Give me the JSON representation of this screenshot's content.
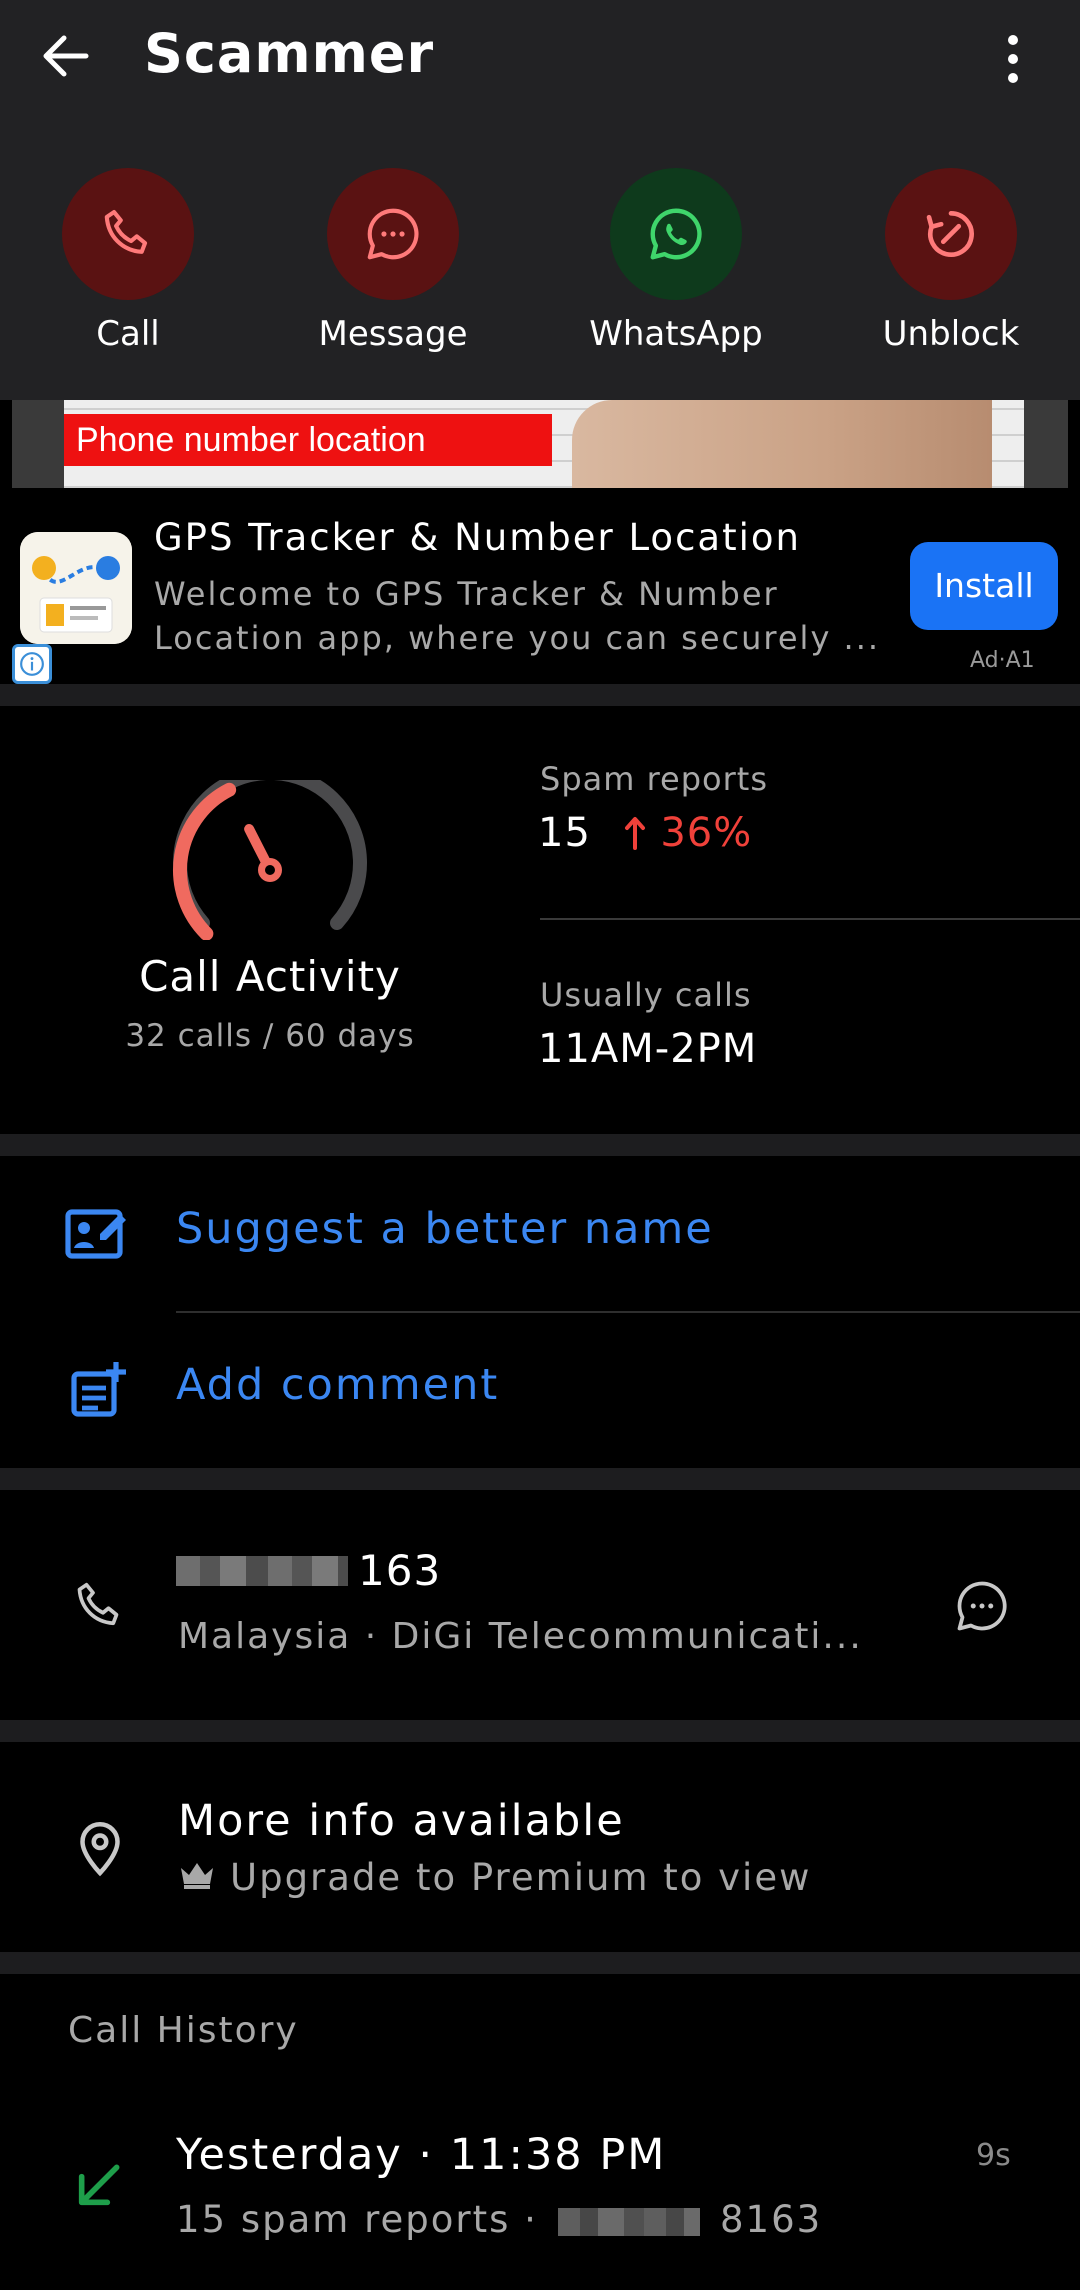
{
  "header": {
    "title": "Scammer",
    "actions": [
      {
        "label": "Call",
        "icon": "phone-icon"
      },
      {
        "label": "Message",
        "icon": "chat-bubble-icon"
      },
      {
        "label": "WhatsApp",
        "icon": "whatsapp-icon"
      },
      {
        "label": "Unblock",
        "icon": "unblock-icon"
      }
    ]
  },
  "ad": {
    "banner_text": "Phone number location",
    "title": "GPS Tracker & Number Location",
    "description": "Welcome to GPS Tracker & Number Location app, where you can securely ...",
    "install_label": "Install",
    "tag": "Ad·A1"
  },
  "stats": {
    "activity_title": "Call Activity",
    "activity_sub": "32 calls / 60 days",
    "gauge_level": 0.4,
    "spam_label": "Spam reports",
    "spam_value": "15",
    "spam_change": "36%",
    "usual_label": "Usually calls",
    "usual_value": "11AM-2PM"
  },
  "actions_list": {
    "suggest_name": "Suggest a better name",
    "add_comment": "Add comment"
  },
  "number_card": {
    "number_tail": "163",
    "carrier_line": "Malaysia · DiGi Telecommunicati..."
  },
  "more_info": {
    "title": "More info available",
    "premium": "Upgrade to Premium to view"
  },
  "history": {
    "heading": "Call History",
    "entries": [
      {
        "when": "Yesterday · 11:38 PM",
        "duration": "9s",
        "spam": "15 spam reports ·",
        "number_tail": "8163"
      }
    ]
  },
  "colors": {
    "accent_blue": "#3b87f2",
    "spam_red": "#f0413a",
    "call_red_bg": "#5a1212",
    "whatsapp_green_bg": "#0e3a1c",
    "incoming_green": "#1e9e4a"
  }
}
